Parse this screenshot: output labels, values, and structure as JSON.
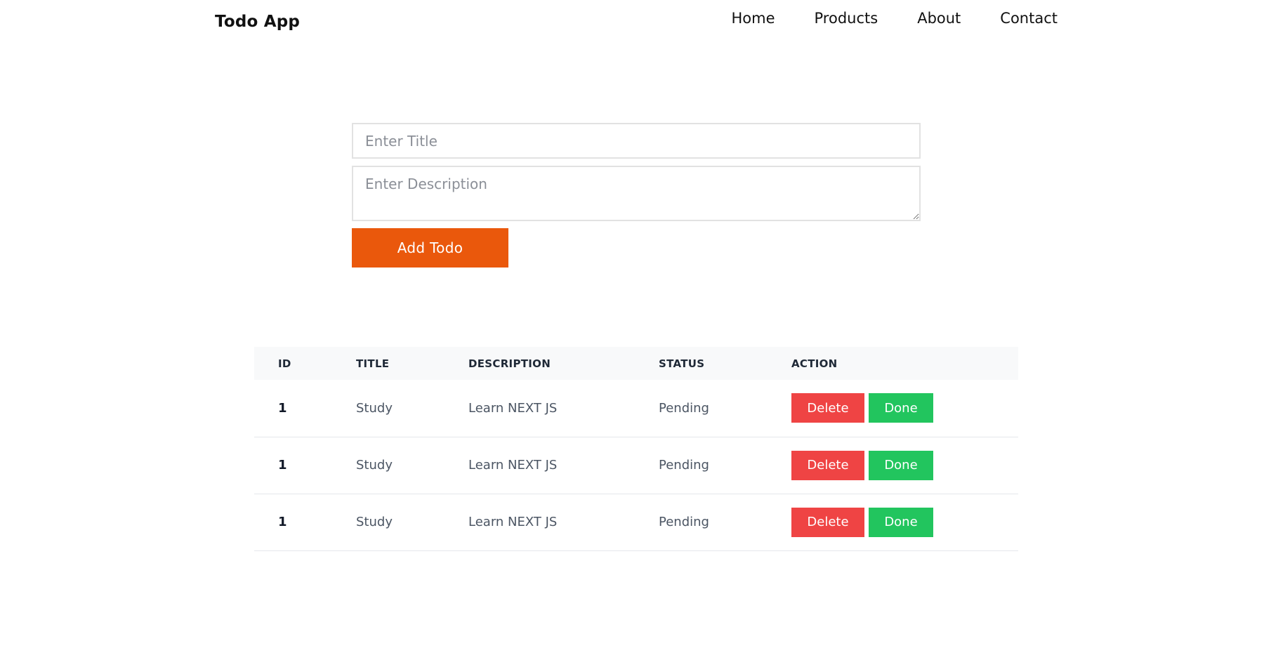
{
  "header": {
    "brand": "Todo App",
    "nav": [
      "Home",
      "Products",
      "About",
      "Contact"
    ]
  },
  "form": {
    "title_placeholder": "Enter Title",
    "description_placeholder": "Enter Description",
    "add_label": "Add Todo"
  },
  "table": {
    "columns": [
      "ID",
      "TITLE",
      "DESCRIPTION",
      "STATUS",
      "ACTION"
    ],
    "rows": [
      {
        "id": "1",
        "title": "Study",
        "description": "Learn NEXT JS",
        "status": "Pending"
      },
      {
        "id": "1",
        "title": "Study",
        "description": "Learn NEXT JS",
        "status": "Pending"
      },
      {
        "id": "1",
        "title": "Study",
        "description": "Learn NEXT JS",
        "status": "Pending"
      }
    ],
    "delete_label": "Delete",
    "done_label": "Done"
  },
  "colors": {
    "accent": "#ea580c",
    "delete": "#ef4444",
    "done": "#22c55e"
  }
}
